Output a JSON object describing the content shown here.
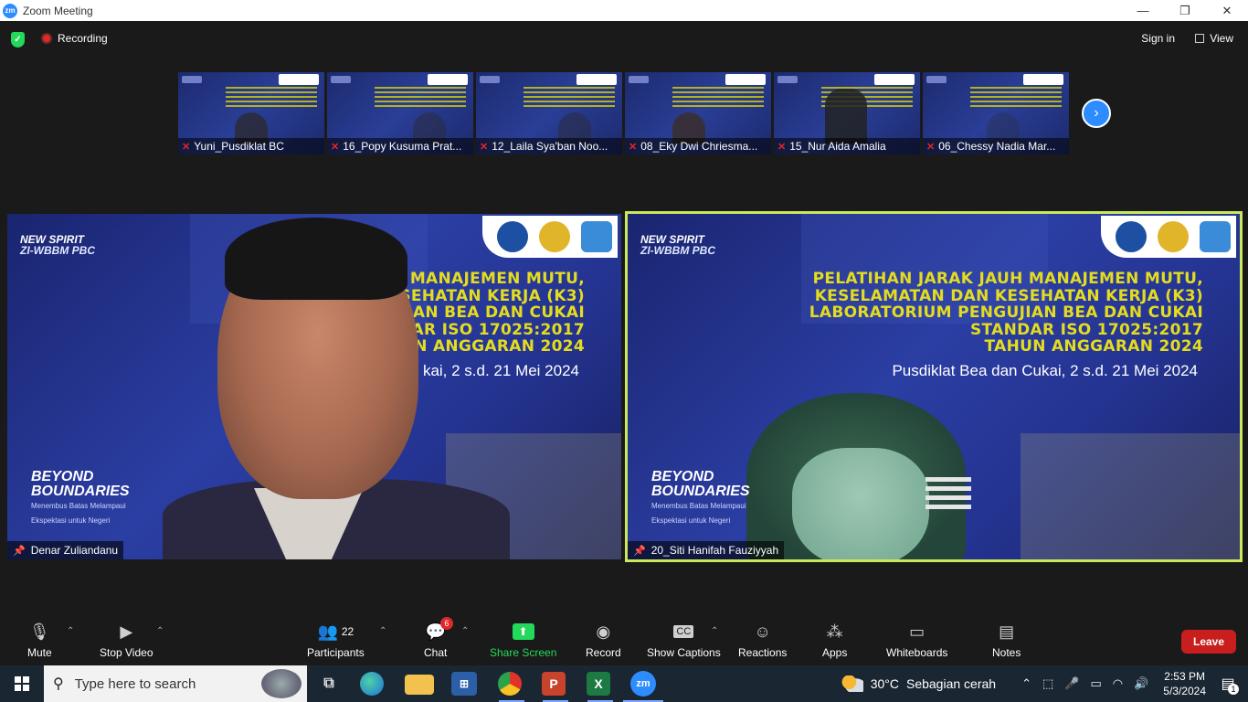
{
  "window": {
    "title": "Zoom Meeting",
    "logo": "zm",
    "controls": {
      "minimize": "—",
      "restore": "❐",
      "close": "✕"
    }
  },
  "topbar": {
    "recording_label": "Recording",
    "signin_label": "Sign in",
    "view_label": "View"
  },
  "thumbnails": [
    {
      "name": "Yuni_Pusdiklat BC"
    },
    {
      "name": "16_Popy Kusuma Prat..."
    },
    {
      "name": "12_Laila Sya'ban Noo..."
    },
    {
      "name": "08_Eky Dwi Chriesma..."
    },
    {
      "name": "15_Nur Aida Amalia"
    },
    {
      "name": "06_Chessy Nadia Mar..."
    }
  ],
  "slide": {
    "spirit_line1": "NEW SPIRIT",
    "spirit_line2": "ZI-WBBM PBC",
    "heading_lines": [
      "PELATIHAN JARAK JAUH MANAJEMEN MUTU,",
      "KESELAMATAN DAN KESEHATAN KERJA (K3)",
      "LABORATORIUM PENGUJIAN BEA DAN CUKAI",
      "STANDAR ISO 17025:2017",
      "TAHUN ANGGARAN 2024"
    ],
    "subline": "Pusdiklat Bea dan Cukai, 2 s.d. 21 Mei 2024",
    "subline_partial": "kai, 2 s.d. 21 Mei 2024",
    "heading_partial": [
      "H MANAJEMEN MUTU,",
      "SEHATAN KERJA (K3)",
      "JIAN BEA DAN CUKAI",
      "DAR ISO 17025:2017",
      "UN ANGGARAN 2024"
    ],
    "beyond_line1": "BEYOND",
    "beyond_line2": "BOUNDARIES",
    "beyond_sub1": "Menembus Batas Melampaui",
    "beyond_sub2": "Ekspektasi untuk Negeri"
  },
  "main_tiles": [
    {
      "name": "Denar Zuliandanu"
    },
    {
      "name": "20_Siti Hanifah Fauziyyah"
    }
  ],
  "toolbar": {
    "mute": "Mute",
    "stop_video": "Stop Video",
    "participants": "Participants",
    "participants_count": "22",
    "chat": "Chat",
    "chat_badge": "6",
    "share_screen": "Share Screen",
    "record": "Record",
    "show_captions": "Show Captions",
    "captions_icon": "CC",
    "reactions": "Reactions",
    "apps": "Apps",
    "whiteboards": "Whiteboards",
    "notes": "Notes",
    "leave": "Leave"
  },
  "taskbar": {
    "search_placeholder": "Type here to search",
    "weather_temp": "30°C",
    "weather_desc": "Sebagian cerah",
    "time": "2:53 PM",
    "date": "5/3/2024",
    "notif_count": "1",
    "zoom_label": "zm",
    "excel_label": "X",
    "ppt_label": "P"
  },
  "colors": {
    "zoom_blue": "#2d8cff",
    "leave_red": "#c91e1e",
    "share_green": "#23d959",
    "active_border": "#c9e85a",
    "slide_yellow": "#e4dc1e"
  }
}
